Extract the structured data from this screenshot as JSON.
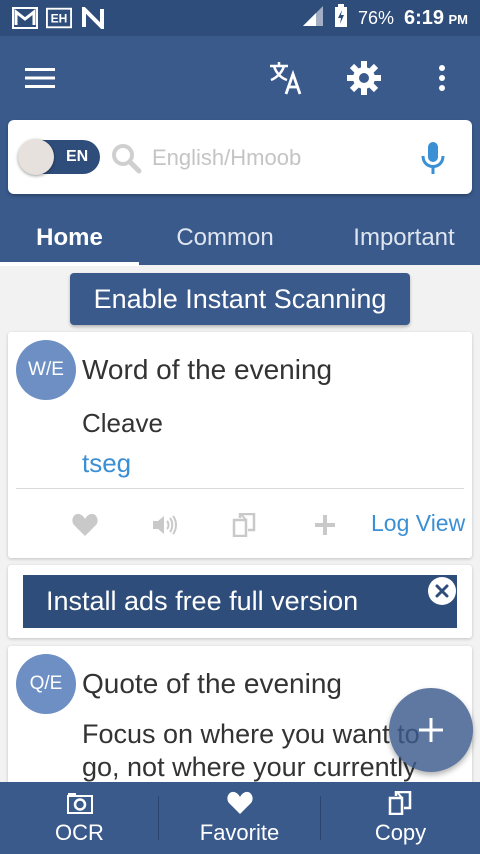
{
  "status_bar": {
    "notification_icons": [
      "gmail-icon",
      "eh-app-icon",
      "n-app-icon"
    ],
    "battery_percent": "76%",
    "time": "6:19",
    "ampm": "PM"
  },
  "app_bar": {
    "icons": [
      "menu-icon",
      "translate-icon",
      "gear-icon",
      "more-vertical-icon"
    ]
  },
  "search": {
    "toggle_label": "EN",
    "placeholder": "English/Hmoob"
  },
  "tabs": [
    {
      "label": "Home",
      "active": true
    },
    {
      "label": "Common",
      "active": false
    },
    {
      "label": "Important",
      "active": false
    }
  ],
  "scan_button": {
    "label": "Enable Instant Scanning"
  },
  "word_card": {
    "avatar": "W/E",
    "title": "Word of the evening",
    "term": "Cleave",
    "translation": "tseg",
    "log_view_label": "Log View"
  },
  "ad_card": {
    "label": "Install ads free full version"
  },
  "quote_card": {
    "avatar": "Q/E",
    "title": "Quote of the evening",
    "text": "Focus on where you want to go, not where your currently"
  },
  "bottom_nav": [
    {
      "label": "OCR",
      "icon": "camera-icon"
    },
    {
      "label": "Favorite",
      "icon": "heart-icon"
    },
    {
      "label": "Copy",
      "icon": "copy-icon"
    }
  ],
  "colors": {
    "primary": "#3a5a8c",
    "primary_dark": "#2f4d7a",
    "link": "#3b8fd4",
    "avatar": "#6d8fc4"
  }
}
